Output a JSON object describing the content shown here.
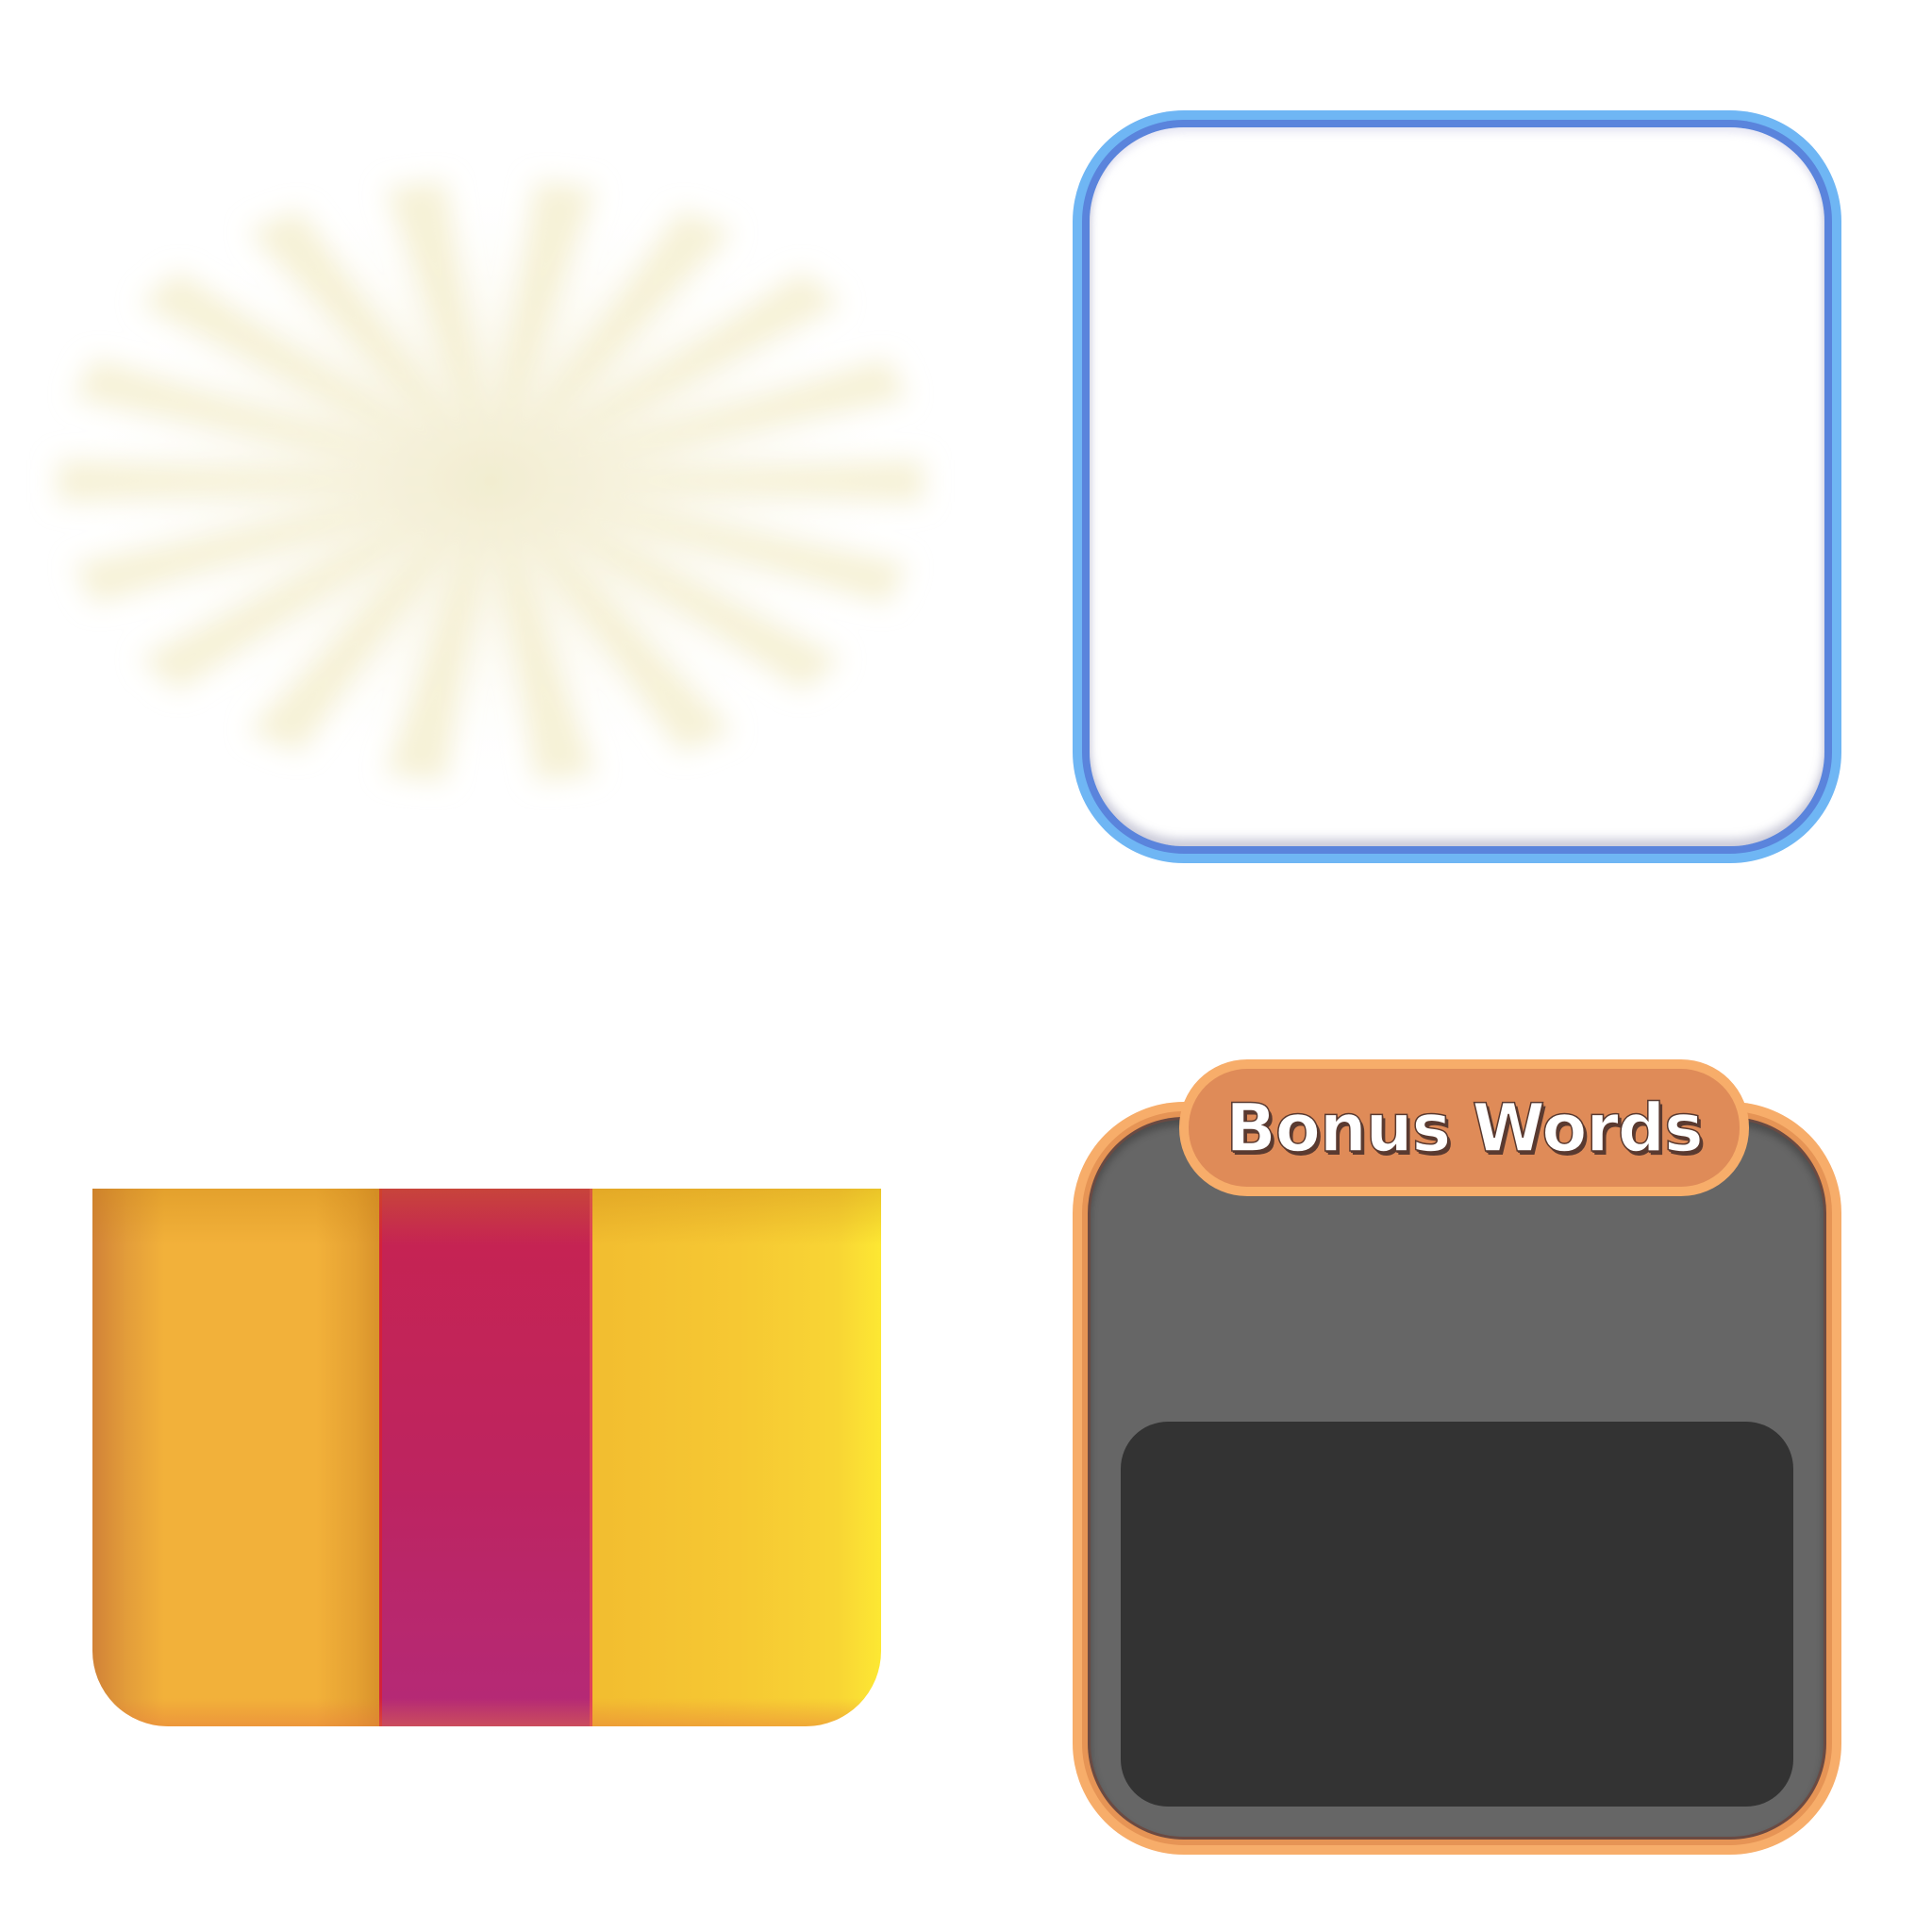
{
  "bonus_panel": {
    "title": "Bonus Words",
    "colors": {
      "outer_border": "#f7ad6a",
      "tab_fill": "#df8b58",
      "body": "#666666",
      "words_area": "#333333"
    }
  },
  "blue_frame": {
    "colors": {
      "outer": "#6fb6f4",
      "inner": "#5a84dc",
      "fill": "#ffffff"
    }
  },
  "stripe_block": {
    "colors": [
      "#f2b13a",
      "#c12356",
      "#f6c833"
    ]
  },
  "sunburst": {
    "color": "#f3ecc8",
    "ray_count": 18
  }
}
